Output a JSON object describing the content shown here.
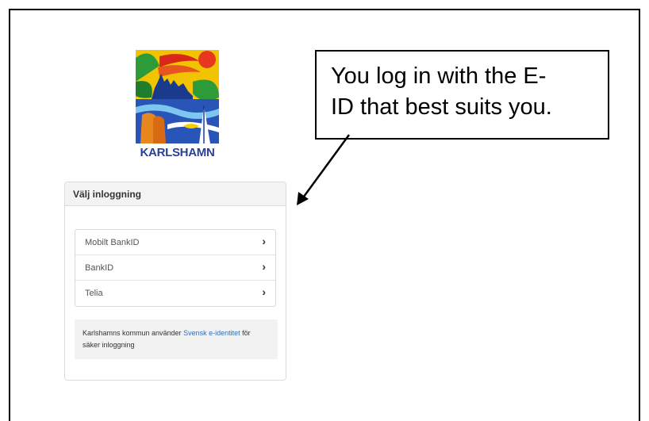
{
  "logo": {
    "text": "KARLSHAMN"
  },
  "panel": {
    "title": "Välj inloggning",
    "options": [
      {
        "label": "Mobilt BankID",
        "chevron": "›"
      },
      {
        "label": "BankID",
        "chevron": "›"
      },
      {
        "label": "Telia",
        "chevron": "›"
      }
    ],
    "info": {
      "prefix": "Karlshamns kommun använder ",
      "link": "Svensk e-identitet",
      "suffix": " för säker inloggning"
    }
  },
  "callout": {
    "line1": "You log in with the E-",
    "line2": "ID that best suits you."
  },
  "colors": {
    "link": "#2f6fb6",
    "logo_text": "#2a3f96",
    "header_bg": "#f3f3f3"
  }
}
